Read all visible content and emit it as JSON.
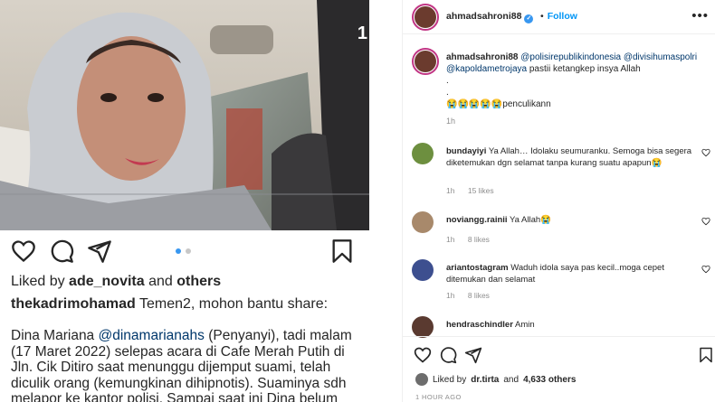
{
  "post": {
    "photo_counter": "1",
    "liked_by_user": "ade_novita",
    "liked_and": "and",
    "liked_others": "others",
    "liked_prefix": "Liked by",
    "caption_user": "thekadrimohamad",
    "caption_first": "Temen2, mohon bantu share:",
    "caption_name": "Dina Mariana",
    "caption_mention": "@dinamarianahs",
    "caption_rest1": "(Penyanyi), tadi malam (17 Maret 2022) selepas acara di Cafe Merah Putih di Jln. Cik Ditiro saat menunggu dijemput suami,  telah diculik orang (kemungkinan dihipnotis). Suaminya sdh melapor ke kantor polisi. Sampai saat ini Dina belum"
  },
  "side": {
    "header": {
      "username": "ahmadsahroni88",
      "verified": "✓",
      "dot": "•",
      "follow": "Follow",
      "more": "•••"
    },
    "caption": {
      "username": "ahmadsahroni88",
      "mentions": "@polisirepublikindonesia @divisihumaspolri @kapoldametrojaya",
      "text": "pastii ketangkep insya Allah",
      "line2": ".",
      "line3": ".",
      "line4_emoji": "😭😭😭😭😭",
      "line4_text": "penculikann",
      "time": "1h"
    },
    "comments": [
      {
        "username": "bundayiyi",
        "text": "Ya Allah… Idolaku seumuranku. Semoga bisa segera diketemukan dgn selamat tanpa kurang suatu apapun😭",
        "time": "1h",
        "likes": "15 likes"
      },
      {
        "username": "noviangg.rainii",
        "text": "Ya Allah😭",
        "time": "1h",
        "likes": "8 likes"
      },
      {
        "username": "ariantostagram",
        "text": "Waduh idola saya pas kecil..moga cepet ditemukan dan selamat",
        "time": "1h",
        "likes": "8 likes"
      },
      {
        "username": "hendraschindler",
        "text": "Amin",
        "time": "",
        "likes": ""
      }
    ],
    "footer": {
      "liked_prefix": "Liked by",
      "liked_user": "dr.tirta",
      "liked_and": "and",
      "liked_count": "4,633 others",
      "time": "1 HOUR AGO"
    }
  },
  "icons": [
    "heart-icon",
    "comment-icon",
    "share-icon",
    "bookmark-icon",
    "more-icon",
    "verified-icon"
  ],
  "colors": {
    "accent_blue": "#0095f6",
    "mention_blue": "#00376b",
    "muted_gray": "#8e8e8e"
  }
}
